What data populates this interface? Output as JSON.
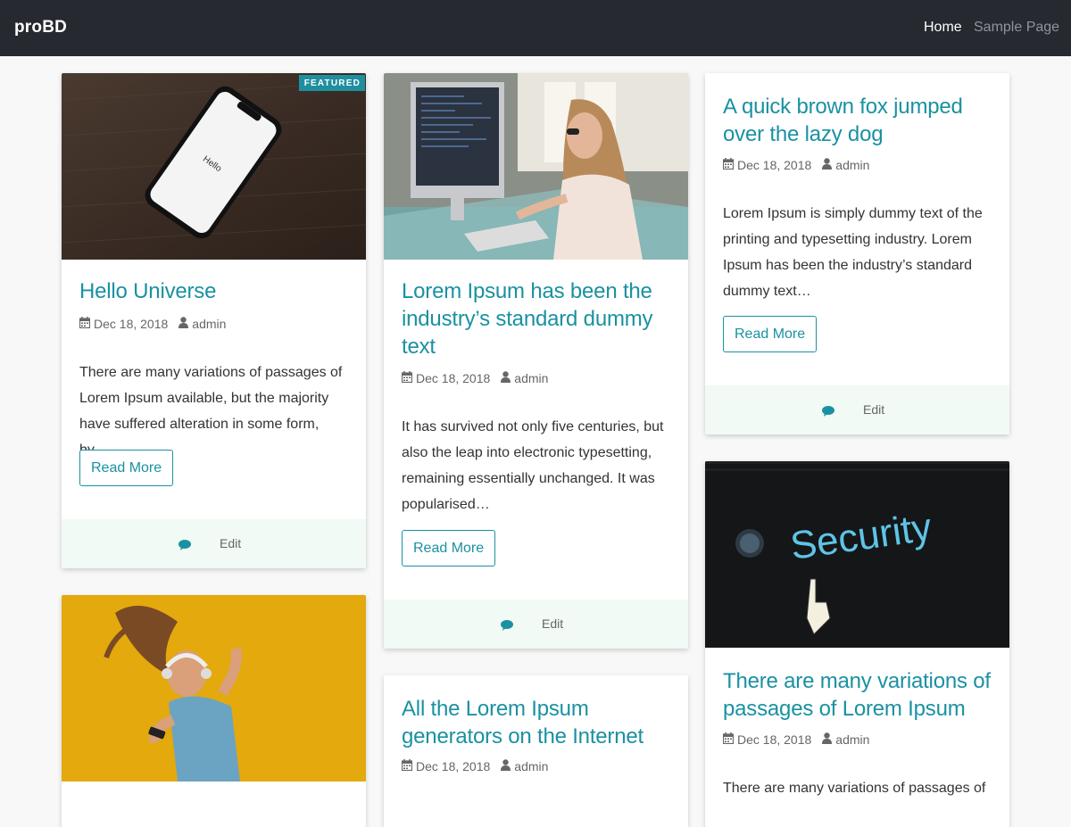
{
  "navbar": {
    "brand": "proBD",
    "links": [
      "Home",
      "Sample Page"
    ]
  },
  "posts": [
    {
      "title": "Hello Universe",
      "date": "Dec 18, 2018",
      "author": "admin",
      "excerpt": "There are many variations of passages of Lorem Ipsum available, but the majority have suffered alteration in some form, by…",
      "badge": "FEATURED",
      "read_more": "Read More",
      "edit": "Edit",
      "image_text": "Hello"
    },
    {
      "title": "Lorem Ipsum has been the industry’s standard dummy text",
      "date": "Dec 18, 2018",
      "author": "admin",
      "excerpt": "It has survived not only five centuries, but also the leap into electronic typesetting, remaining essentially unchanged. It was popularised…",
      "read_more": "Read More",
      "edit": "Edit"
    },
    {
      "title": "A quick brown fox jumped over the lazy dog",
      "date": "Dec 18, 2018",
      "author": "admin",
      "excerpt": "Lorem Ipsum is simply dummy text of the printing and typesetting industry. Lorem Ipsum has been the industry’s standard dummy text…",
      "read_more": "Read More",
      "edit": "Edit"
    },
    {
      "title": "All the Lorem Ipsum generators on the Internet",
      "date": "Dec 18, 2018",
      "author": "admin"
    },
    {
      "title": "There are many variations of passages of Lorem Ipsum",
      "date": "Dec 18, 2018",
      "author": "admin",
      "excerpt": "There are many variations of passages of",
      "image_text": "Security"
    }
  ],
  "colors": {
    "accent": "#1a91a2",
    "navbar": "#262a30",
    "footer": "#f1faf5"
  }
}
